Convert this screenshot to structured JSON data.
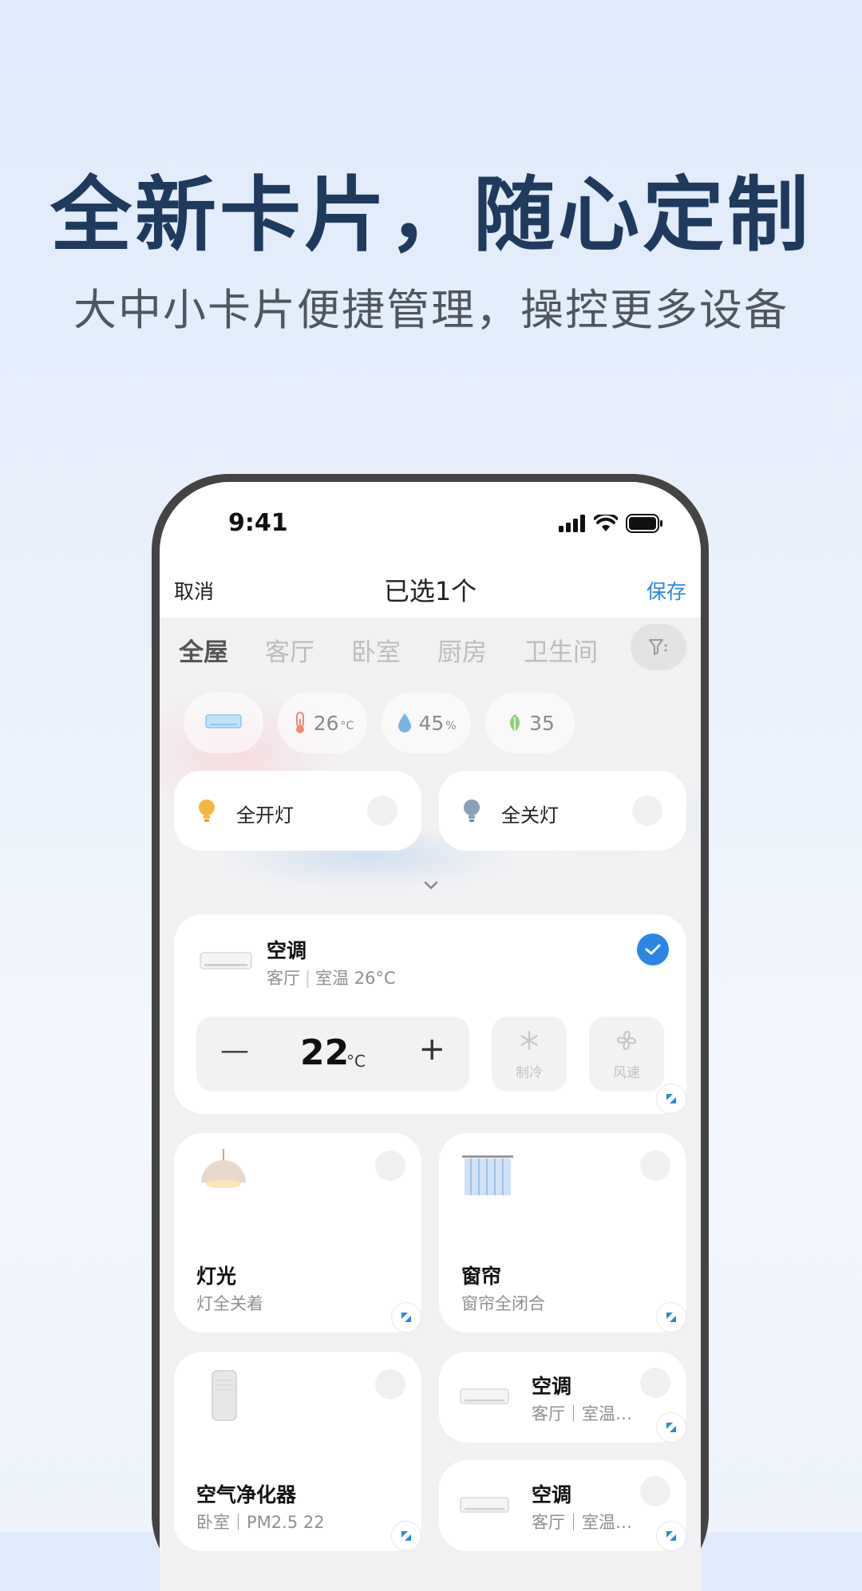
{
  "hero": {
    "title": "全新卡片，随心定制",
    "subtitle": "大中小卡片便捷管理，操控更多设备"
  },
  "status_bar": {
    "time": "9:41"
  },
  "nav": {
    "cancel": "取消",
    "title": "已选1个",
    "save": "保存"
  },
  "room_tabs": [
    "全屋",
    "客厅",
    "卧室",
    "厨房",
    "卫生间"
  ],
  "active_tab": "全屋",
  "env_chips": [
    {
      "icon": "ac-icon",
      "value": "",
      "unit": ""
    },
    {
      "icon": "thermometer-icon",
      "value": "26",
      "unit": "°C"
    },
    {
      "icon": "humidity-icon",
      "value": "45",
      "unit": "%"
    },
    {
      "icon": "leaf-icon",
      "value": "35",
      "unit": ""
    }
  ],
  "quick_actions": [
    {
      "label": "全开灯",
      "icon": "bulb-on-icon"
    },
    {
      "label": "全关灯",
      "icon": "bulb-off-icon"
    }
  ],
  "ac_card": {
    "title": "空调",
    "room": "客厅",
    "status": "室温 26°C",
    "selected": true,
    "temperature": "22",
    "temp_unit": "°C",
    "minus": "—",
    "plus": "+",
    "mode_label": "制冷",
    "fan_label": "风速"
  },
  "cards": {
    "light": {
      "title": "灯光",
      "sub": "灯全关着"
    },
    "curtain": {
      "title": "窗帘",
      "sub": "窗帘全闭合"
    },
    "purifier": {
      "title": "空气净化器",
      "sub": "卧室｜PM2.5 22"
    },
    "ac_small_1": {
      "title": "空调",
      "sub": "客厅｜室温…"
    },
    "ac_small_2": {
      "title": "空调",
      "sub": "客厅｜室温…"
    }
  },
  "colors": {
    "accent": "#2a86e6",
    "title": "#1e3a5f"
  }
}
